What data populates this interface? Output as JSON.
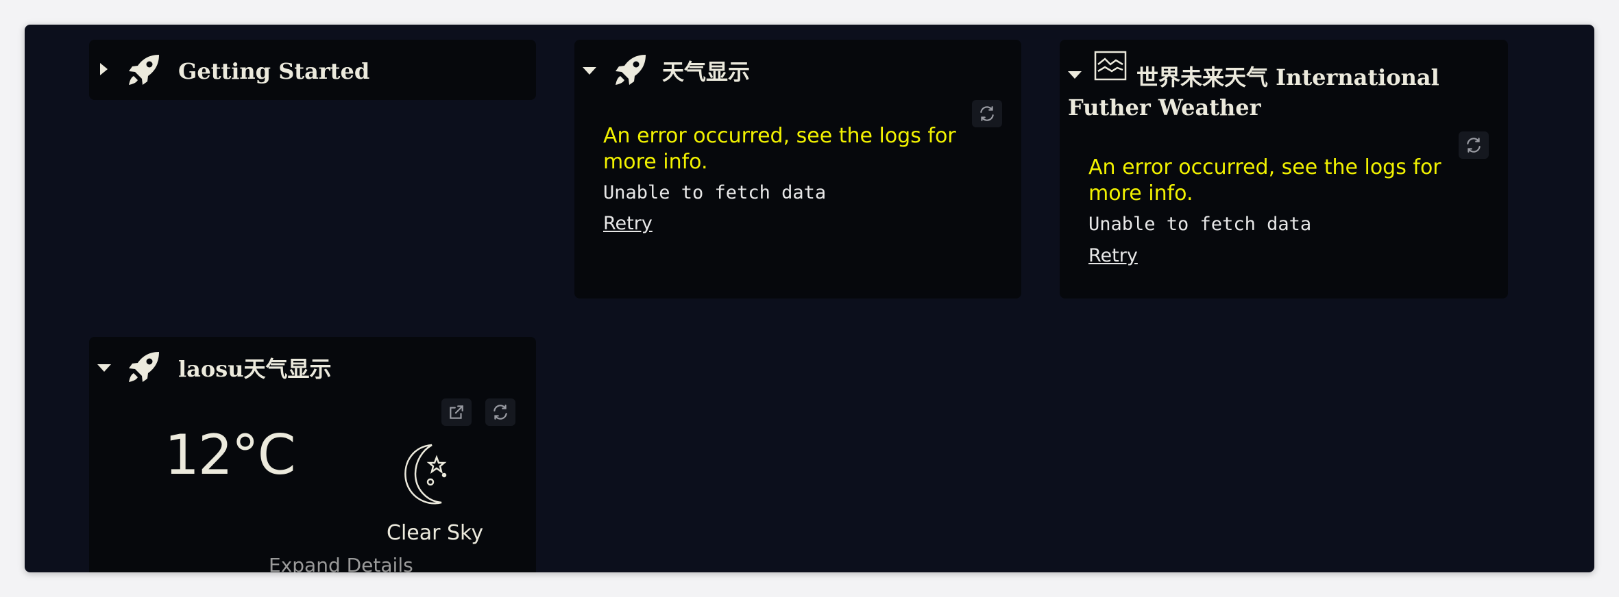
{
  "widgets": {
    "getting_started": {
      "title": "Getting Started",
      "icon": "rocket-icon"
    },
    "weather_cn": {
      "title": "天气显示",
      "icon": "rocket-icon",
      "error": "An error occurred, see the logs for more info.",
      "message": "Unable to fetch data",
      "retry_label": "Retry"
    },
    "world_weather": {
      "title_line1": "世界未来天气 International",
      "title_line2": "Futher Weather",
      "icon": "chart-icon",
      "error": "An error occurred, see the logs for more info.",
      "message": "Unable to fetch data",
      "retry_label": "Retry"
    },
    "laosu_weather": {
      "title": "laosu天气显示",
      "icon": "rocket-icon",
      "temperature": "12°C",
      "condition": "Clear Sky",
      "condition_icon": "moon-stars-icon",
      "expand_label": "Expand Details"
    }
  },
  "colors": {
    "background": "#0c0f1c",
    "panel": "#06080c",
    "error_text": "#f2f200",
    "title_text": "#eceadd"
  }
}
